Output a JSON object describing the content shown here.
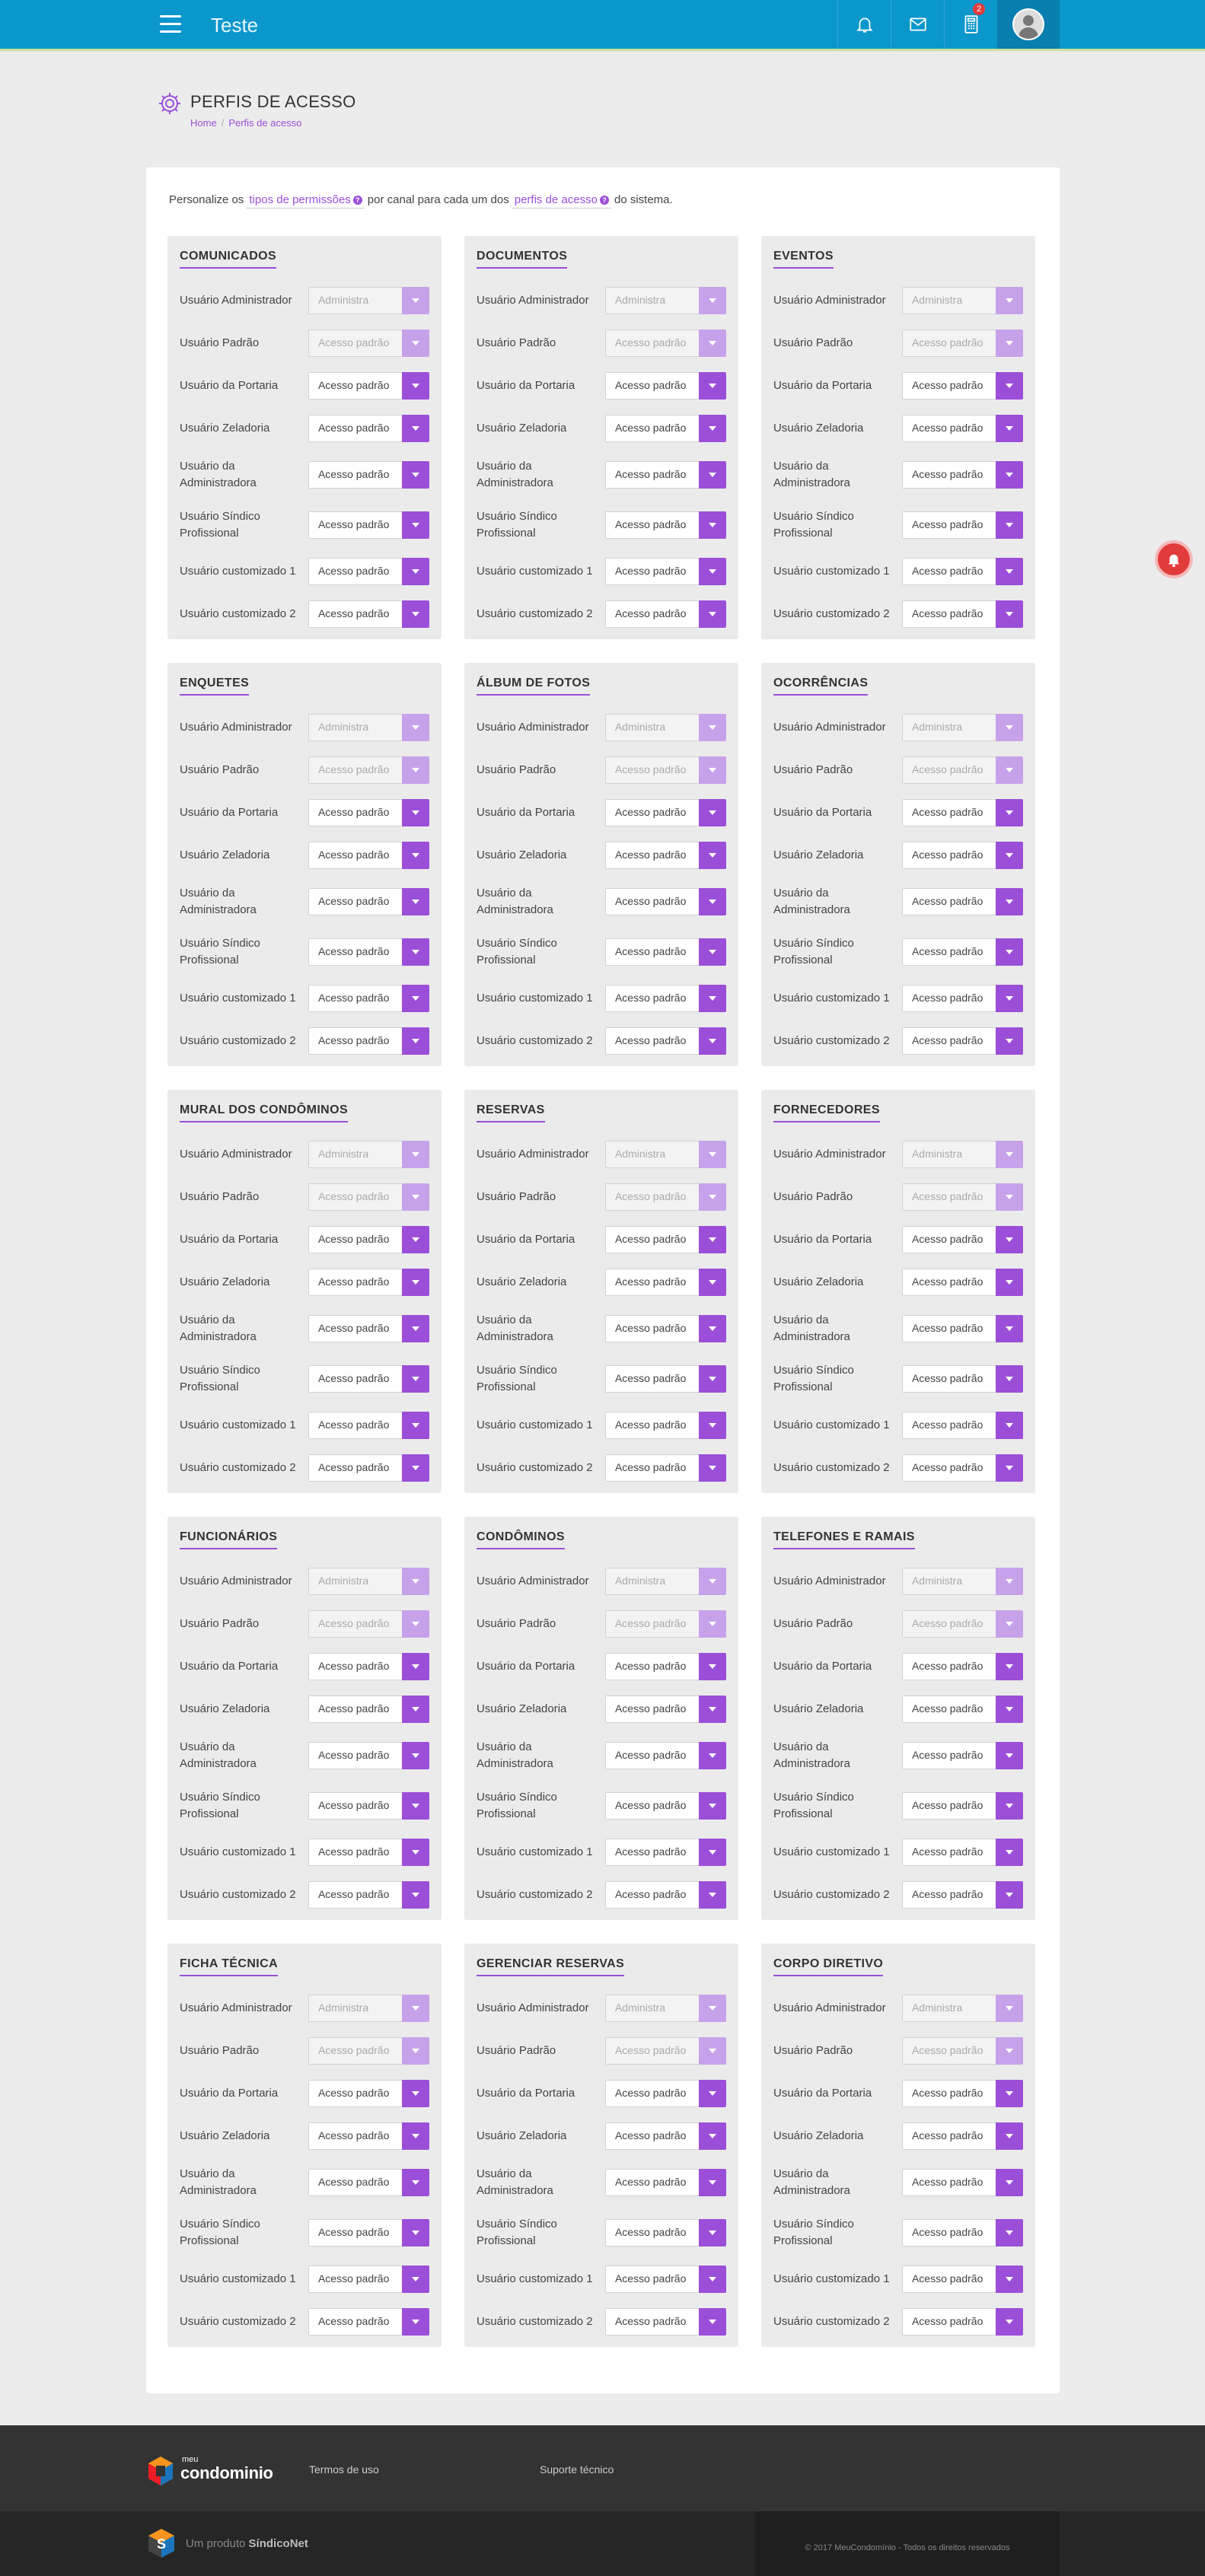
{
  "header": {
    "app_title": "Teste",
    "notifications_badge": "",
    "calc_badge": "2",
    "colors": {
      "bar": "#0b97cc",
      "accent": "#9b4fd8"
    }
  },
  "page": {
    "title": "PERFIS DE ACESSO",
    "breadcrumb": {
      "home": "Home",
      "separator": "/",
      "current": "Perfis de acesso"
    }
  },
  "intro": {
    "part1": "Personalize os",
    "link1": "tipos de permissões",
    "part2": "por canal para cada um dos",
    "link2": "perfis de acesso",
    "part3": "do sistema."
  },
  "panels": [
    {
      "title": "COMUNICADOS"
    },
    {
      "title": "DOCUMENTOS"
    },
    {
      "title": "EVENTOS"
    },
    {
      "title": "ENQUETES"
    },
    {
      "title": "ÁLBUM DE FOTOS"
    },
    {
      "title": "OCORRÊNCIAS"
    },
    {
      "title": "MURAL DOS CONDÔMINOS"
    },
    {
      "title": "RESERVAS"
    },
    {
      "title": "FORNECEDORES"
    },
    {
      "title": "FUNCIONÁRIOS"
    },
    {
      "title": "CONDÔMINOS"
    },
    {
      "title": "TELEFONES E RAMAIS"
    },
    {
      "title": "FICHA TÉCNICA"
    },
    {
      "title": "GERENCIAR RESERVAS"
    },
    {
      "title": "CORPO DIRETIVO"
    }
  ],
  "profiles": [
    {
      "label": "Usuário Administrador",
      "value": "Administra",
      "disabled": true
    },
    {
      "label": "Usuário Padrão",
      "value": "Acesso padrão",
      "disabled": true
    },
    {
      "label": "Usuário da Portaria",
      "value": "Acesso padrão",
      "disabled": false
    },
    {
      "label": "Usuário Zeladoria",
      "value": "Acesso padrão",
      "disabled": false
    },
    {
      "label": "Usuário da Administradora",
      "value": "Acesso padrão",
      "disabled": false
    },
    {
      "label": "Usuário Síndico Profissional",
      "value": "Acesso padrão",
      "disabled": false
    },
    {
      "label": "Usuário customizado 1",
      "value": "Acesso padrão",
      "disabled": false
    },
    {
      "label": "Usuário customizado 2",
      "value": "Acesso padrão",
      "disabled": false
    }
  ],
  "footer": {
    "logo_meu": "meu",
    "logo_cond": "condominio",
    "terms": "Termos de uso",
    "support": "Suporte técnico",
    "produto_prefix": "Um produto",
    "produto_brand": "SíndicoNet",
    "copyright": "© 2017 MeuCondomínio - Todos os direitos reservados"
  }
}
